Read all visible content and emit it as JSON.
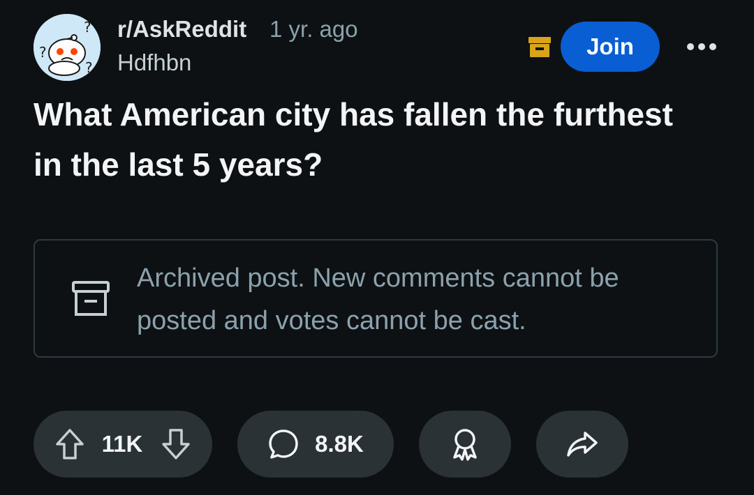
{
  "post_header": {
    "subreddit": "r/AskReddit",
    "age": "1 yr. ago",
    "author": "Hdfhbn",
    "join_label": "Join",
    "icons": {
      "avatar": "askreddit-snoo-icon",
      "archived": "archive-box-icon",
      "more": "more-dots-icon"
    },
    "colors": {
      "join_button": "#0a5ed3",
      "archive_badge": "#d8a51a"
    }
  },
  "post": {
    "title": "What American city has fallen the furthest in the last 5 years?"
  },
  "archive_notice": {
    "text": "Archived post. New comments cannot be posted and votes cannot be cast.",
    "icon": "archive-box-icon"
  },
  "actions": {
    "vote_count": "11K",
    "comment_count": "8.8K",
    "icons": [
      "upvote-arrow-icon",
      "downvote-arrow-icon",
      "comment-bubble-icon",
      "award-ribbon-icon",
      "share-arrow-icon"
    ]
  },
  "theme": {
    "background": "#0e1113",
    "pill": "#2a3236",
    "muted_text": "#8ba2ad"
  }
}
